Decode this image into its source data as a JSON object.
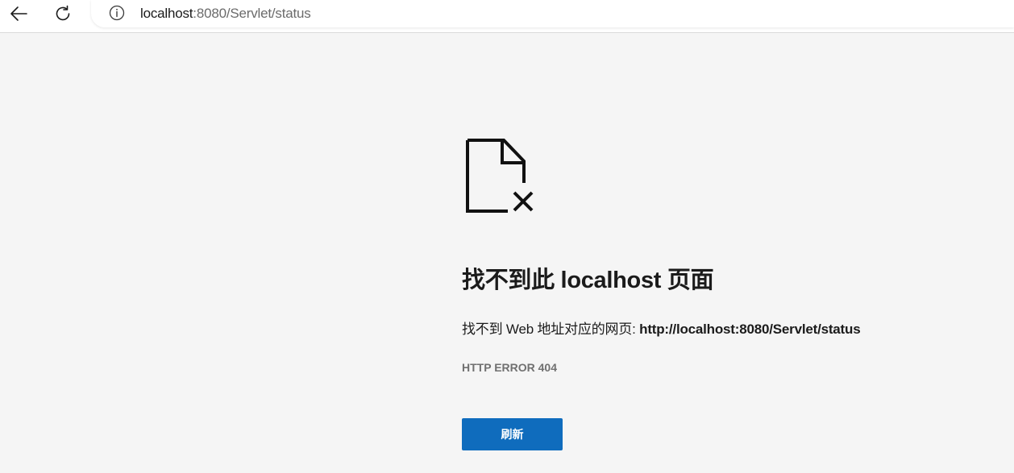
{
  "toolbar": {
    "back_icon": "arrow-left-icon",
    "reload_icon": "reload-icon",
    "info_icon": "info-icon",
    "url_host": "localhost",
    "url_rest": ":8080/Servlet/status"
  },
  "error_page": {
    "icon": "document-x-icon",
    "title": "找不到此 localhost 页面",
    "description_prefix": "找不到 Web 地址对应的网页: ",
    "description_url": "http://localhost:8080/Servlet/status",
    "error_code": "HTTP ERROR 404",
    "refresh_label": "刷新",
    "refresh_color": "#0f6cbd"
  }
}
